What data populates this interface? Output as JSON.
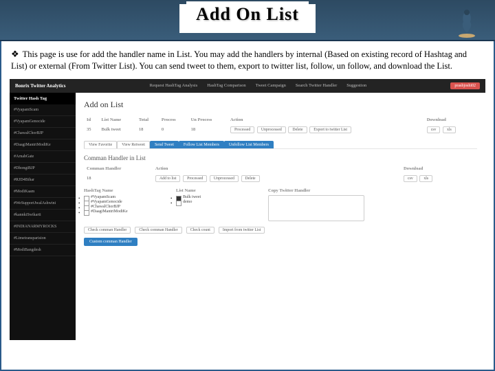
{
  "slide": {
    "title": "Add On List",
    "description": "This page is use for add the handler name in List.  You may add the handlers by internal (Based on existing record of Hashtag and List) or external (From Twitter List). You can send  tweet to them, export to twitter list, follow, un follow, and download the List."
  },
  "app": {
    "brand": "Bonrix Twitter Analytics",
    "nav": {
      "n1": "Request HashTag Analysis",
      "n2": "HashTag Comparison",
      "n3": "Tweet Campaign",
      "n4": "Search Twitter Handler",
      "n5": "Suggestion"
    },
    "user": "prashjoshi02",
    "sidebar": {
      "section": "Twitter Hash Tag",
      "items": [
        "#VyapamScam",
        "#VyapamGenocide",
        "#ChawalChorBJP",
        "#DaagiMantriModiKe",
        "#ArnabGate",
        "#DhongiBJP",
        "#RJD4Bihar",
        "#ModiKaam",
        "#WeSupportJwalAshwini",
        "#kannkiSwikarti",
        "#INDIANARMYROCKS",
        "#Limetransparision",
        "#ModiBangdesh"
      ]
    },
    "main": {
      "page_title": "Add on List",
      "table_headers": [
        "Id",
        "List Name",
        "Total",
        "Process",
        "Un Process",
        "Action"
      ],
      "download_hdr": "Download",
      "row": {
        "id": "35",
        "list": "Bulk tweet",
        "total": "18",
        "process": "0",
        "unprocess": "18"
      },
      "row_actions": {
        "a1": "Processed",
        "a2": "Unprocessed",
        "a3": "Delete",
        "a4": "Export to twitter List"
      },
      "dl": {
        "csv": "csv",
        "xls": "xls"
      },
      "tabs": {
        "t1": "View Favorite",
        "t2": "View Retweet",
        "t3": "Send Tweet",
        "t4": "Follow List Members",
        "t5": "Unfollow List Members"
      },
      "section2_title": "Comman Handler in List",
      "s2_headers": [
        "Comman Handler",
        "Action"
      ],
      "s2_val": "18",
      "s2_actions": {
        "a1": "Add to list",
        "a2": "Processed",
        "a3": "Unprocessed",
        "a4": "Delete"
      },
      "col1": {
        "title": "HashTag Name",
        "items": [
          "#VyapamScam",
          "#VyapamGenocide",
          "#ChawalChorBJP",
          "#DaagiMantriModiKe"
        ]
      },
      "col2": {
        "title": "List Name",
        "items": [
          "Bulk tweet",
          "demo"
        ]
      },
      "col3": {
        "title": "Copy Twitter Handler"
      },
      "foot": {
        "b1": "Check comman Handler",
        "b2": "Check comman Handler",
        "b3": "Check count",
        "b4": "Import from twitter List"
      },
      "custom": "Custom comman Handler"
    }
  }
}
